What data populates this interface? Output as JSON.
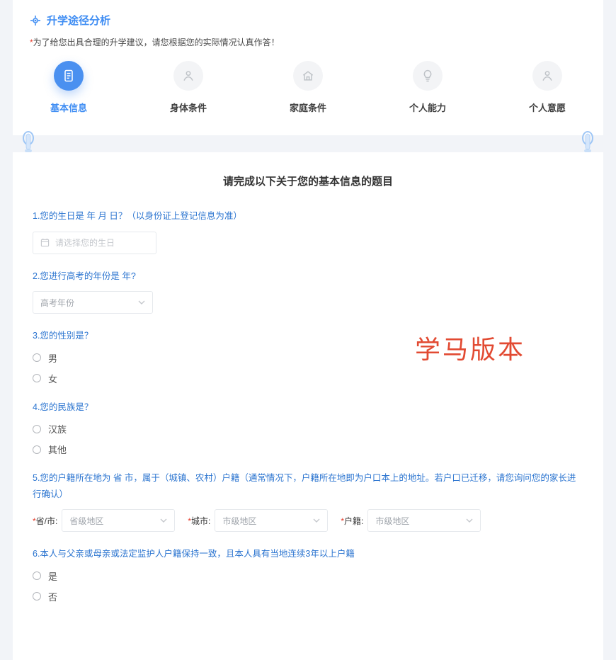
{
  "header": {
    "title": "升学途径分析",
    "warning_prefix": "*",
    "warning": "为了给您出具合理的升学建议，请您根据您的实际情况认真作答！"
  },
  "tabs": [
    {
      "label": "基本信息"
    },
    {
      "label": "身体条件"
    },
    {
      "label": "家庭条件"
    },
    {
      "label": "个人能力"
    },
    {
      "label": "个人意愿"
    }
  ],
  "main": {
    "title": "请完成以下关于您的基本信息的题目"
  },
  "watermark": "学马版本",
  "q1": {
    "label": "1.您的生日是 年 月 日？（以身份证上登记信息为准）",
    "placeholder": "请选择您的生日"
  },
  "q2": {
    "label": "2.您进行高考的年份是 年?",
    "placeholder": "高考年份"
  },
  "q3": {
    "label": "3.您的性别是？",
    "opt1": "男",
    "opt2": "女"
  },
  "q4": {
    "label": "4.您的民族是？",
    "opt1": "汉族",
    "opt2": "其他"
  },
  "q5": {
    "label": "5.您的户籍所在地为 省 市，属于（城镇、农村）户籍（通常情况下，户籍所在地即为户口本上的地址。若户口已迁移，请您询问您的家长进行确认）",
    "g1_label_star": "*",
    "g1_label": "省/市:",
    "g1_ph": "省级地区",
    "g2_label_star": "*",
    "g2_label": "城市:",
    "g2_ph": "市级地区",
    "g3_label_star": "*",
    "g3_label": "户籍:",
    "g3_ph": "市级地区"
  },
  "q6": {
    "label": "6.本人与父亲或母亲或法定监护人户籍保持一致，且本人具有当地连续3年以上户籍",
    "opt1": "是",
    "opt2": "否"
  }
}
